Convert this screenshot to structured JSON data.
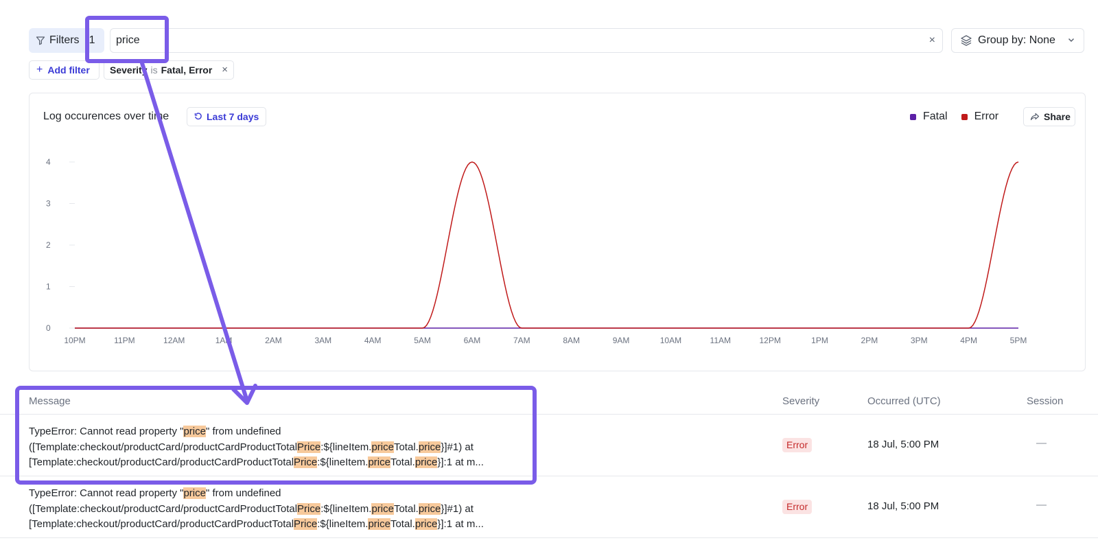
{
  "toolbar": {
    "filters_label": "Filters",
    "filters_count": "1",
    "search_value": "price",
    "clear_symbol": "×",
    "group_by_label": "Group by: None"
  },
  "active_filters": {
    "add_filter_label": "Add filter",
    "chip": {
      "field": "Severity",
      "operator": "is",
      "value": "Fatal, Error",
      "remove_symbol": "×"
    }
  },
  "chart_card": {
    "title": "Log occurences over time",
    "range_label": "Last 7 days",
    "share_label": "Share",
    "legend": [
      {
        "name": "Fatal",
        "color": "#5b1fa6"
      },
      {
        "name": "Error",
        "color": "#c01a1a"
      }
    ]
  },
  "chart_data": {
    "type": "line",
    "x": [
      "10PM",
      "11PM",
      "12AM",
      "1AM",
      "2AM",
      "3AM",
      "4AM",
      "5AM",
      "6AM",
      "7AM",
      "8AM",
      "9AM",
      "10AM",
      "11AM",
      "12PM",
      "1PM",
      "2PM",
      "3PM",
      "4PM",
      "5PM"
    ],
    "series": [
      {
        "name": "Fatal",
        "color": "#5b1fa6",
        "values": [
          0,
          0,
          0,
          0,
          0,
          0,
          0,
          0,
          0,
          0,
          0,
          0,
          0,
          0,
          0,
          0,
          0,
          0,
          0,
          0
        ]
      },
      {
        "name": "Error",
        "color": "#c01a1a",
        "values": [
          0,
          0,
          0,
          0,
          0,
          0,
          0,
          0,
          4,
          0,
          0,
          0,
          0,
          0,
          0,
          0,
          0,
          0,
          0,
          4
        ]
      }
    ],
    "yticks": [
      0,
      1,
      2,
      3,
      4
    ],
    "ylim": [
      0,
      4
    ],
    "grid": true,
    "legend_position": "top-right"
  },
  "table": {
    "columns": [
      "Message",
      "Severity",
      "Occurred (UTC)",
      "Session"
    ],
    "rows": [
      {
        "message_lines": [
          [
            {
              "t": "TypeError: Cannot read property \""
            },
            {
              "t": "price",
              "h": true
            },
            {
              "t": "\" from undefined"
            }
          ],
          [
            {
              "t": "([Template:checkout/productCard/productCardProductTotal"
            },
            {
              "t": "Price",
              "h": true
            },
            {
              "t": ":${lineItem."
            },
            {
              "t": "price",
              "h": true
            },
            {
              "t": "Total."
            },
            {
              "t": "price",
              "h": true
            },
            {
              "t": "}]#1) at"
            }
          ],
          [
            {
              "t": "[Template:checkout/productCard/productCardProductTotal"
            },
            {
              "t": "Price",
              "h": true
            },
            {
              "t": ":${lineItem."
            },
            {
              "t": "price",
              "h": true
            },
            {
              "t": "Total."
            },
            {
              "t": "price",
              "h": true
            },
            {
              "t": "}]:1 at m..."
            }
          ]
        ],
        "severity": "Error",
        "occurred": "18 Jul, 5:00 PM",
        "session": "—"
      },
      {
        "message_lines": [
          [
            {
              "t": "TypeError: Cannot read property \""
            },
            {
              "t": "price",
              "h": true
            },
            {
              "t": "\" from undefined"
            }
          ],
          [
            {
              "t": "([Template:checkout/productCard/productCardProductTotal"
            },
            {
              "t": "Price",
              "h": true
            },
            {
              "t": ":${lineItem."
            },
            {
              "t": "price",
              "h": true
            },
            {
              "t": "Total."
            },
            {
              "t": "price",
              "h": true
            },
            {
              "t": "}]#1) at"
            }
          ],
          [
            {
              "t": "[Template:checkout/productCard/productCardProductTotal"
            },
            {
              "t": "Price",
              "h": true
            },
            {
              "t": ":${lineItem."
            },
            {
              "t": "price",
              "h": true
            },
            {
              "t": "Total."
            },
            {
              "t": "price",
              "h": true
            },
            {
              "t": "}]:1 at m..."
            }
          ]
        ],
        "severity": "Error",
        "occurred": "18 Jul, 5:00 PM",
        "session": "—"
      }
    ]
  },
  "annotation": {
    "color": "#7a5ce8"
  }
}
